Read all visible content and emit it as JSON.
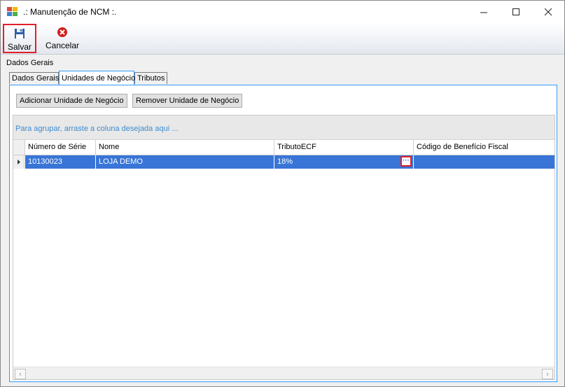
{
  "window": {
    "title": ".: Manutenção de NCM :."
  },
  "toolbar": {
    "save_label": "Salvar",
    "cancel_label": "Cancelar"
  },
  "panel": {
    "title": "Dados Gerais"
  },
  "tabs": [
    {
      "label": "Dados Gerais",
      "active": false
    },
    {
      "label": "Unidades de Negócio",
      "active": true
    },
    {
      "label": "Tributos",
      "active": false
    }
  ],
  "actions": {
    "add_label": "Adicionar Unidade de Negócio",
    "remove_label": "Remover Unidade de Negócio"
  },
  "grid": {
    "group_hint": "Para agrupar, arraste a coluna desejada aqui ...",
    "columns": [
      "Número de Série",
      "Nome",
      "TributoECF",
      "Código de Benefício Fiscal"
    ],
    "rows": [
      {
        "numero_serie": "10130023",
        "nome": "LOJA DEMO",
        "tributo_ecf": "18%",
        "codigo_beneficio": ""
      }
    ]
  },
  "colors": {
    "selection": "#3875d7",
    "highlight_border": "#e0202a",
    "group_text": "#3d8bd0"
  },
  "icons": {
    "app": "app-icon",
    "save": "floppy-disk-icon",
    "cancel": "cancel-x-icon"
  }
}
